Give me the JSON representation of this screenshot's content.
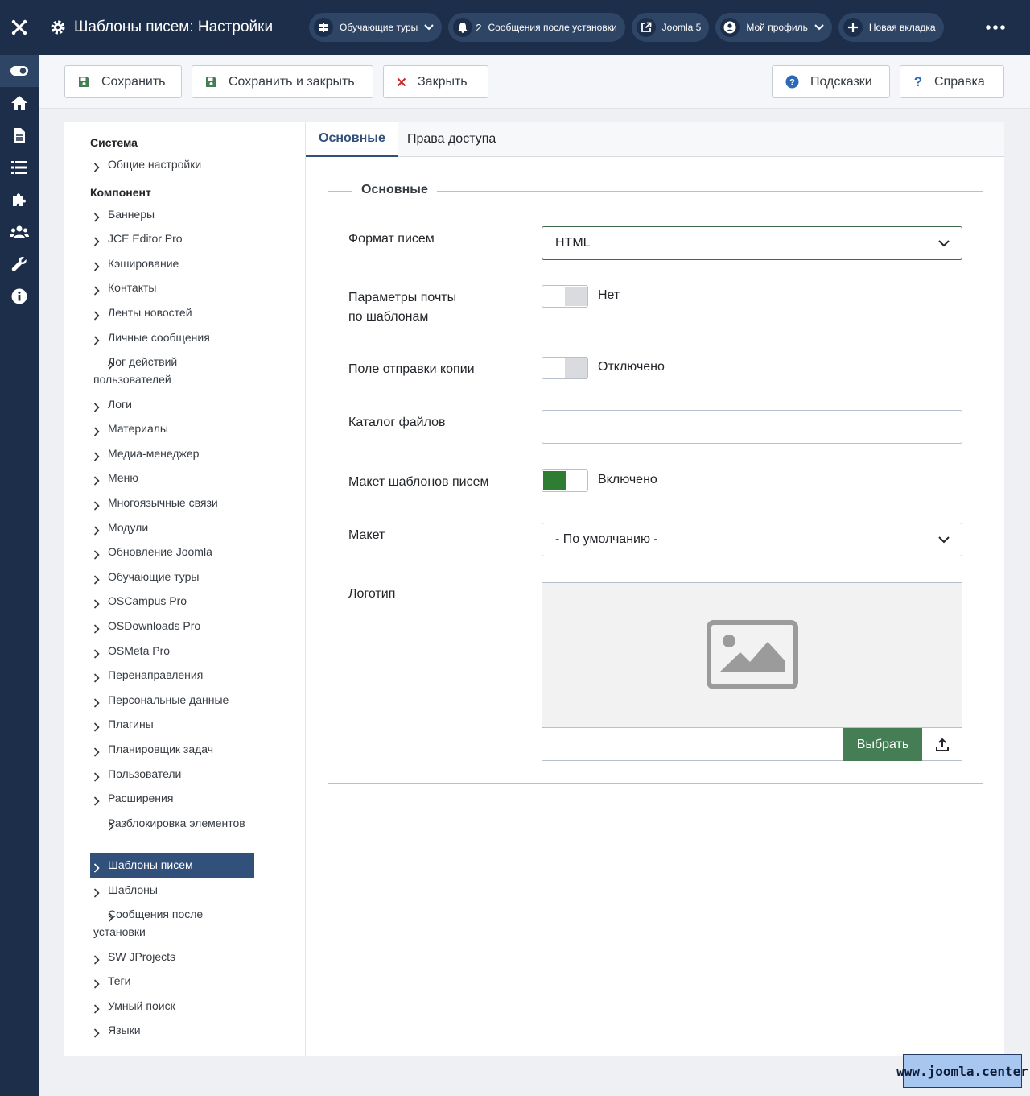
{
  "header": {
    "title": "Шаблоны писем: Настройки",
    "pills": [
      {
        "label": "Обучающие туры",
        "icon": "signpost-icon"
      },
      {
        "count": "2",
        "label": "Сообщения после установки",
        "icon": "bell-icon"
      },
      {
        "label": "Joomla 5",
        "icon": "external-link-icon"
      },
      {
        "label": "Мой профиль",
        "icon": "user-circle-icon"
      },
      {
        "label": "Новая вкладка",
        "icon": "plus-icon"
      }
    ]
  },
  "toolbar": {
    "save": "Сохранить",
    "save_close": "Сохранить и закрыть",
    "close": "Закрыть",
    "hints": "Подсказки",
    "help": "Справка"
  },
  "nav": {
    "system_heading": "Система",
    "system_items": [
      "Общие настройки"
    ],
    "component_heading": "Компонент",
    "items": [
      "Баннеры",
      "JCE Editor Pro",
      "Кэширование",
      "Контакты",
      "Ленты новостей",
      "Личные сообщения",
      "Лог действий пользователей",
      "Логи",
      "Материалы",
      "Медиа-менеджер",
      "Меню",
      "Многоязычные связи",
      "Модули",
      "Обновление Joomla",
      "Обучающие туры",
      "OSCampus Pro",
      "OSDownloads Pro",
      "OSMeta Pro",
      "Перенаправления",
      "Персональные данные",
      "Плагины",
      "Планировщик задач",
      "Пользователи",
      "Расширения",
      "Разблокировка элементов",
      "Шаблоны писем",
      "Шаблоны",
      "Сообщения после установки",
      "SW JProjects",
      "Теги",
      "Умный поиск",
      "Языки"
    ],
    "active_item": "Шаблоны писем"
  },
  "tabs": [
    "Основные",
    "Права доступа"
  ],
  "form": {
    "legend": "Основные",
    "mail_format_label": "Формат писем",
    "mail_format_value": "HTML",
    "template_mail_label_1": "Параметры почты",
    "template_mail_label_2": "по шаблонам",
    "template_mail_value": "Нет",
    "copy_field_label": "Поле отправки копии",
    "copy_field_value": "Отключено",
    "attachment_dir_label": "Каталог файлов",
    "attachment_dir_value": "",
    "layout_enable_label": "Макет шаблонов писем",
    "layout_enable_value": "Включено",
    "layout_label": "Макет",
    "layout_value": "- По умолчанию -",
    "logo_label": "Логотип",
    "logo_pick": "Выбрать"
  },
  "watermark": "www.joomla.center",
  "colors": {
    "header_bg": "#1c2e4a",
    "active_nav": "#31507a",
    "switch_on": "#2e7d32",
    "pick_button": "#457d54"
  }
}
